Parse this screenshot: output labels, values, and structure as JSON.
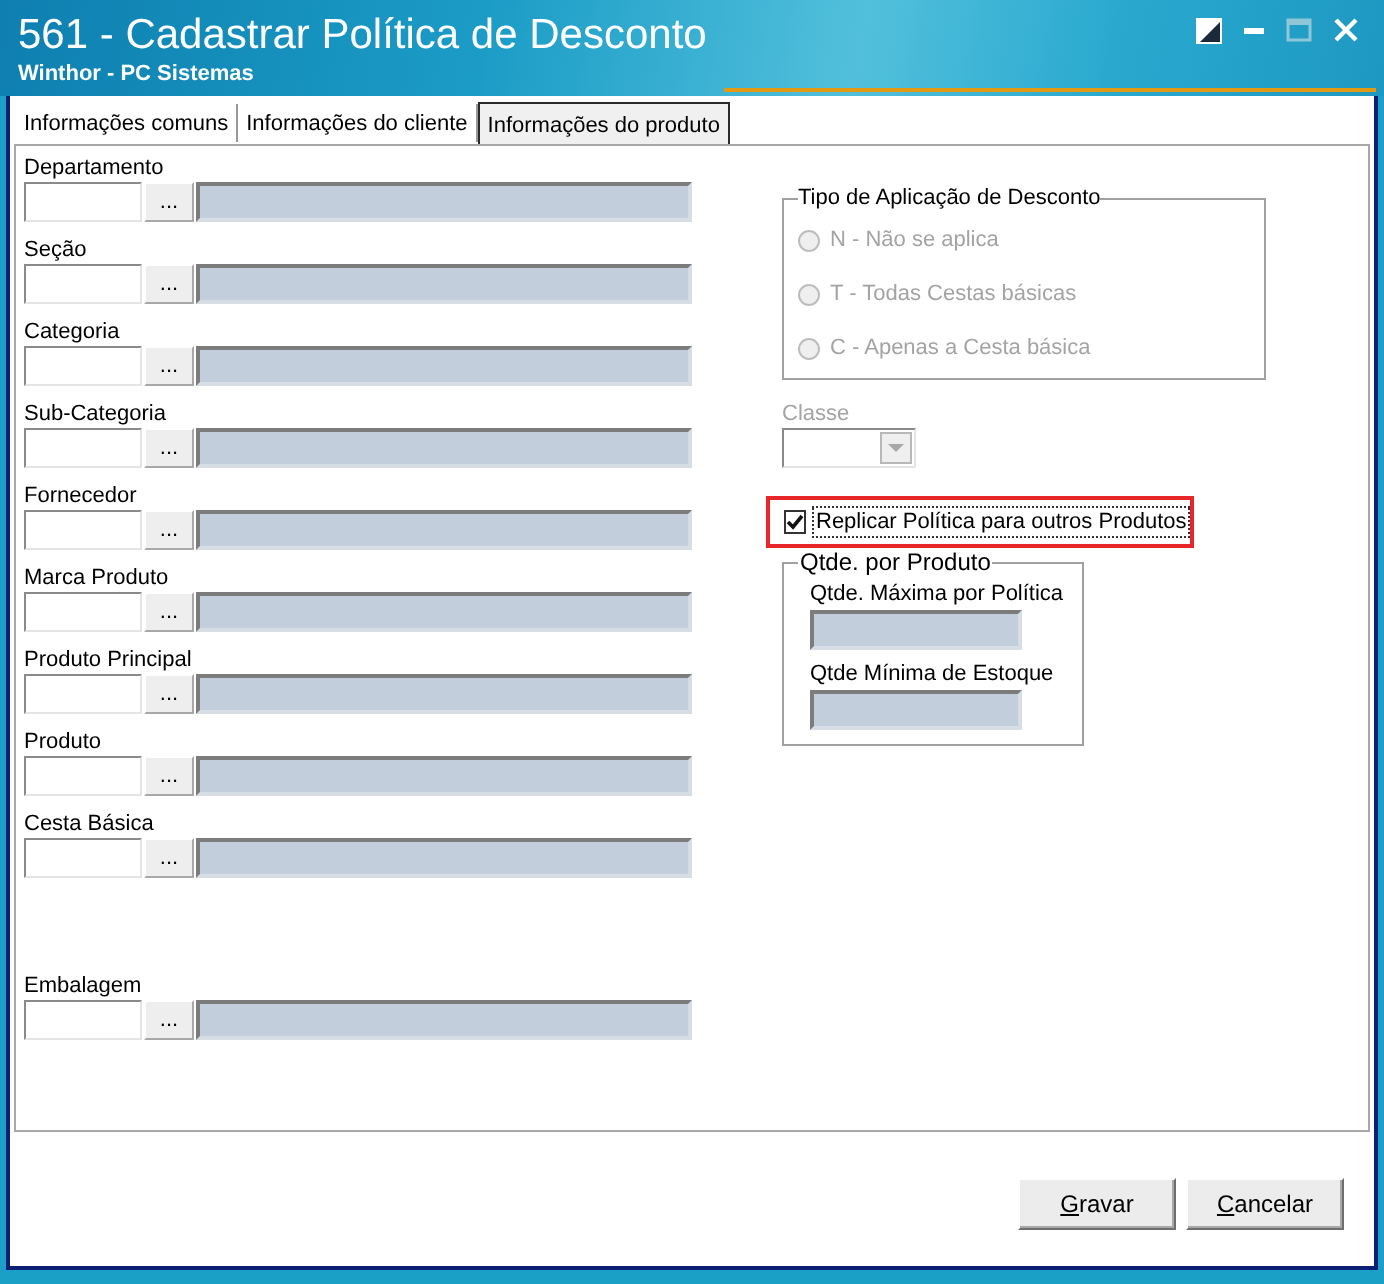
{
  "window": {
    "title": "561 - Cadastrar Política de Desconto",
    "subtitle": "Winthor - PC Sistemas",
    "controls": [
      {
        "kind": "dock",
        "disabled": false
      },
      {
        "kind": "minimize",
        "disabled": false
      },
      {
        "kind": "maximize",
        "disabled": true
      },
      {
        "kind": "close",
        "disabled": false
      }
    ]
  },
  "tabs": [
    {
      "label": "Informações comuns",
      "selected": false
    },
    {
      "label": "Informações do cliente",
      "selected": false
    },
    {
      "label": "Informações do produto",
      "selected": true
    }
  ],
  "filters": [
    {
      "label": "Departamento",
      "button": "...",
      "description_disabled": true
    },
    {
      "label": "Seção",
      "button": "...",
      "description_disabled": true
    },
    {
      "label": "Categoria",
      "button": "...",
      "description_disabled": true
    },
    {
      "label": "Sub-Categoria",
      "button": "...",
      "description_disabled": true
    },
    {
      "label": "Fornecedor",
      "button": "...",
      "description_disabled": true
    },
    {
      "label": "Marca Produto",
      "button": "...",
      "description_disabled": true
    },
    {
      "label": "Produto Principal",
      "button": "...",
      "description_disabled": true
    },
    {
      "label": "Produto",
      "button": "...",
      "description_disabled": true
    },
    {
      "label": "Cesta Básica",
      "button": "...",
      "description_disabled": true
    }
  ],
  "extra_filters": [
    {
      "label": "Embalagem",
      "button": "...",
      "description_disabled": true
    }
  ],
  "discount_type": {
    "title": "Tipo de Aplicação de Desconto",
    "disabled": true,
    "options": [
      {
        "label": "N - Não se aplica",
        "selected": false
      },
      {
        "label": "T - Todas Cestas básicas",
        "selected": false
      },
      {
        "label": "C - Apenas a Cesta básica",
        "selected": false
      }
    ]
  },
  "classe": {
    "label": "Classe",
    "disabled": true
  },
  "replicate": {
    "label": "Replicar Política para outros Produtos",
    "checked": true,
    "focused": true,
    "highlighted": true
  },
  "quantity_group": {
    "title": "Qtde. por Produto",
    "fields": [
      {
        "label": "Qtde. Máxima por Política",
        "disabled": true
      },
      {
        "label": "Qtde Mínima de Estoque",
        "disabled": true
      }
    ]
  },
  "buttons": [
    {
      "label": "Gravar",
      "underline_first": true
    },
    {
      "label": "Cancelar",
      "underline_first": true
    }
  ]
}
